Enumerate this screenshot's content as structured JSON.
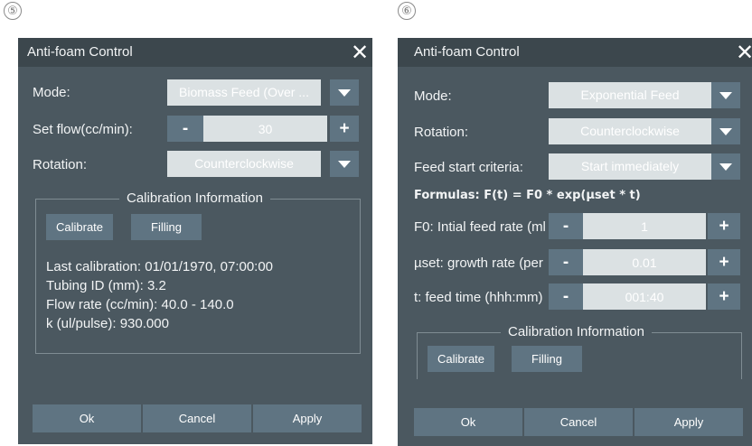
{
  "panel5": {
    "step_number": "⑤",
    "title": "Anti-foam Control",
    "close_glyph": "✕",
    "mode_label": "Mode:",
    "mode_value": "Biomass Feed (Over ...",
    "set_flow_label": "Set flow(cc/min):",
    "decrement_label": "-",
    "flow_value": "30",
    "increment_label": "+",
    "rotation_label": "Rotation:",
    "rotation_value": "Counterclockwise",
    "calibration_title": "Calibration Information",
    "calibrate_label": "Calibrate",
    "filling_label": "Filling",
    "info_lines": [
      "Last calibration: 01/01/1970, 07:00:00",
      "Tubing ID (mm): 3.2",
      "Flow rate (cc/min): 40.0 - 140.0",
      "k (ul/pulse): 930.000"
    ],
    "ok_label": "Ok",
    "cancel_label": "Cancel",
    "apply_label": "Apply"
  },
  "panel6": {
    "step_number": "⑥",
    "title": "Anti-foam Control",
    "close_glyph": "✕",
    "mode_label": "Mode:",
    "mode_value": "Exponential Feed",
    "rotation_label": "Rotation:",
    "rotation_value": "Counterclockwise",
    "feed_start_label": "Feed start criteria:",
    "feed_start_value": "Start immediately",
    "formula": "Formulas: F(t) = F0 * exp(µset * t)",
    "f0_label": "F0: Intial feed rate (ml",
    "f0_value": "1",
    "mu_label": "µset: growth rate (per",
    "mu_value": "0.01",
    "t_label": "t: feed time (hhh:mm)",
    "t_value": "001:40",
    "decrement_label": "-",
    "increment_label": "+",
    "calibration_title": "Calibration Information",
    "calibrate_label": "Calibrate",
    "filling_label": "Filling",
    "ok_label": "Ok",
    "cancel_label": "Cancel",
    "apply_label": "Apply"
  },
  "colors": {
    "dialog_bg": "#4b5860",
    "header_bg": "#3c474d",
    "button_bg": "#5f7482",
    "field_bg": "#dbe1e3"
  },
  "icons": [
    "close-icon",
    "dropdown-caret-icon"
  ]
}
